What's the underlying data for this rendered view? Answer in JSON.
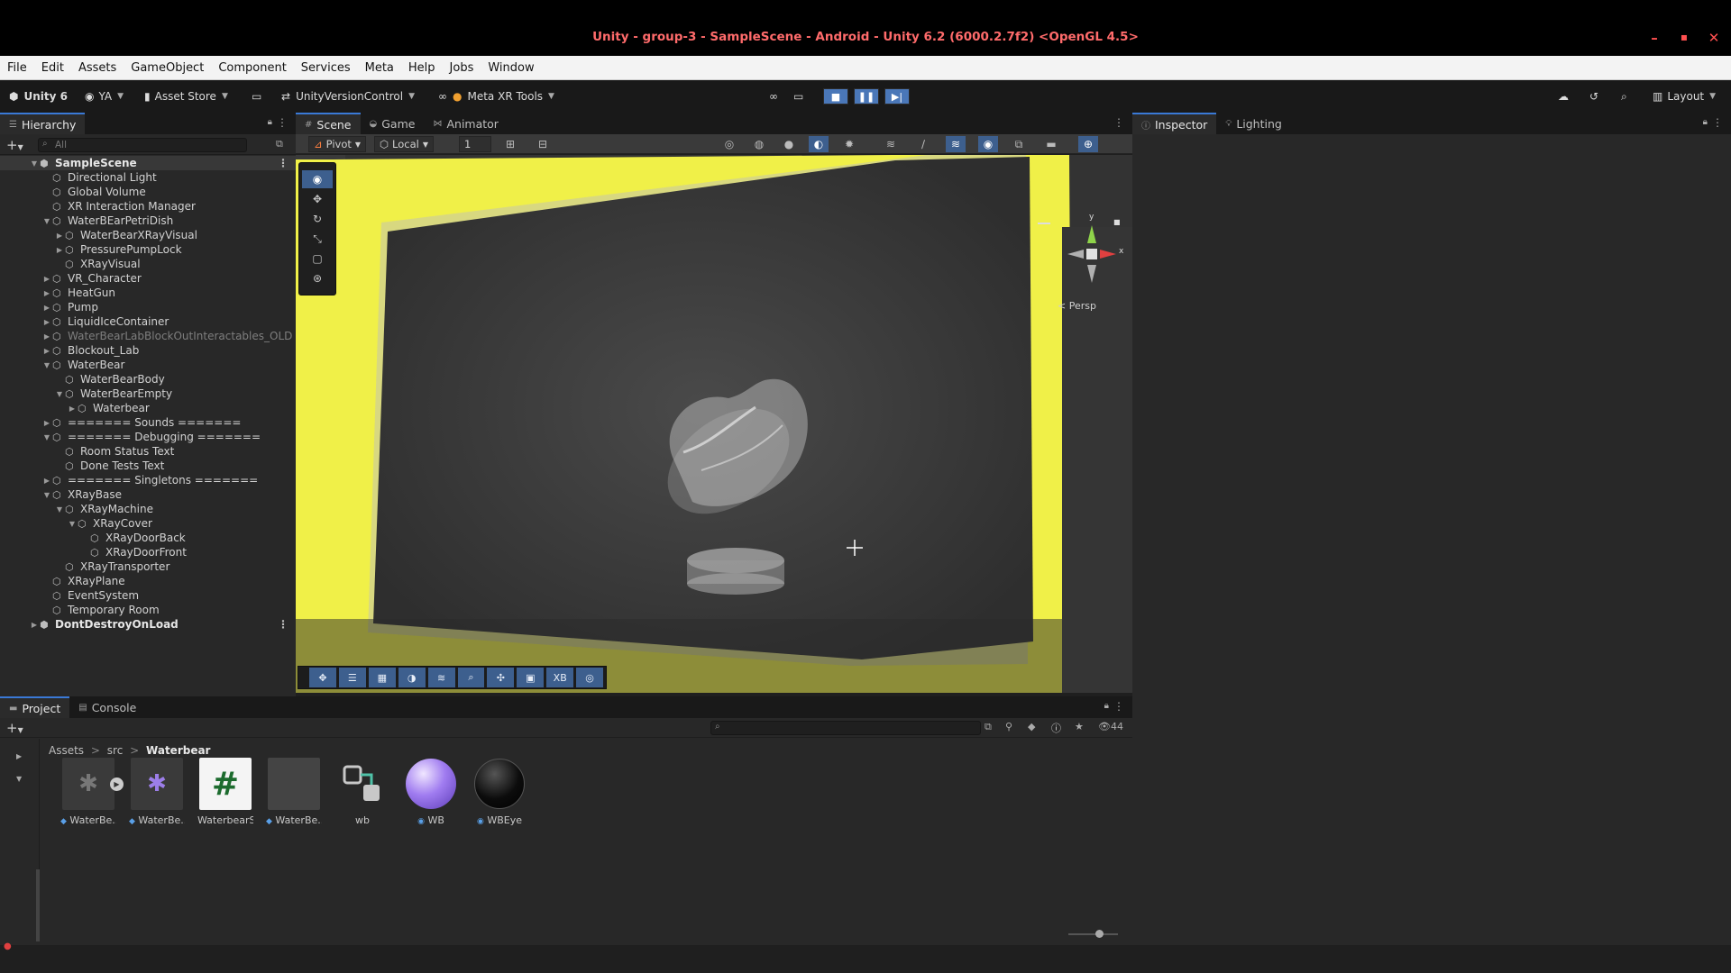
{
  "window": {
    "title": "Unity - group-3 - SampleScene - Android - Unity 6.2 (6000.2.7f2) <OpenGL 4.5>",
    "controls": [
      "–",
      "▪",
      "✕"
    ]
  },
  "menu": [
    "File",
    "Edit",
    "Assets",
    "GameObject",
    "Component",
    "Services",
    "Meta",
    "Help",
    "Jobs",
    "Window"
  ],
  "toolbar": {
    "unity": "Unity 6",
    "account": "YA",
    "asset_store": "Asset Store",
    "vcs": "UnityVersionControl",
    "meta": "Meta XR Tools",
    "layout": "Layout"
  },
  "hierarchy": {
    "tab": "Hierarchy",
    "search_placeholder": "All",
    "rows": [
      {
        "label": "SampleScene",
        "depth": 0,
        "arrow": "▼",
        "kind": "scene"
      },
      {
        "label": "Directional Light",
        "depth": 1,
        "arrow": ""
      },
      {
        "label": "Global Volume",
        "depth": 1,
        "arrow": ""
      },
      {
        "label": "XR Interaction Manager",
        "depth": 1,
        "arrow": ""
      },
      {
        "label": "WaterBEarPetriDish",
        "depth": 1,
        "arrow": "▼"
      },
      {
        "label": "WaterBearXRayVisual",
        "depth": 2,
        "arrow": "▶"
      },
      {
        "label": "PressurePumpLock",
        "depth": 2,
        "arrow": "▶"
      },
      {
        "label": "XRayVisual",
        "depth": 2,
        "arrow": ""
      },
      {
        "label": "VR_Character",
        "depth": 1,
        "arrow": "▶"
      },
      {
        "label": "HeatGun",
        "depth": 1,
        "arrow": "▶"
      },
      {
        "label": "Pump",
        "depth": 1,
        "arrow": "▶"
      },
      {
        "label": "LiquidIceContainer",
        "depth": 1,
        "arrow": "▶"
      },
      {
        "label": "WaterBearLabBlockOutInteractables_OLD",
        "depth": 1,
        "arrow": "▶",
        "kind": "dim"
      },
      {
        "label": "Blockout_Lab",
        "depth": 1,
        "arrow": "▶"
      },
      {
        "label": "WaterBear",
        "depth": 1,
        "arrow": "▼"
      },
      {
        "label": "WaterBearBody",
        "depth": 2,
        "arrow": ""
      },
      {
        "label": "WaterBearEmpty",
        "depth": 2,
        "arrow": "▼"
      },
      {
        "label": "Waterbear",
        "depth": 3,
        "arrow": "▶"
      },
      {
        "label": "======= Sounds =======",
        "depth": 1,
        "arrow": "▶"
      },
      {
        "label": "======= Debugging =======",
        "depth": 1,
        "arrow": "▼"
      },
      {
        "label": "Room Status Text",
        "depth": 2,
        "arrow": ""
      },
      {
        "label": "Done Tests Text",
        "depth": 2,
        "arrow": ""
      },
      {
        "label": "======= Singletons =======",
        "depth": 1,
        "arrow": "▶"
      },
      {
        "label": "XRayBase",
        "depth": 1,
        "arrow": "▼"
      },
      {
        "label": "XRayMachine",
        "depth": 2,
        "arrow": "▼"
      },
      {
        "label": "XRayCover",
        "depth": 3,
        "arrow": "▼"
      },
      {
        "label": "XRayDoorBack",
        "depth": 4,
        "arrow": ""
      },
      {
        "label": "XRayDoorFront",
        "depth": 4,
        "arrow": ""
      },
      {
        "label": "XRayTransporter",
        "depth": 2,
        "arrow": ""
      },
      {
        "label": "XRayPlane",
        "depth": 1,
        "arrow": ""
      },
      {
        "label": "EventSystem",
        "depth": 1,
        "arrow": ""
      },
      {
        "label": "Temporary Room",
        "depth": 1,
        "arrow": ""
      },
      {
        "label": "DontDestroyOnLoad",
        "depth": 0,
        "arrow": "▶",
        "kind": "scene"
      }
    ]
  },
  "scene": {
    "tabs": [
      "Scene",
      "Game",
      "Animator"
    ],
    "pivot": "Pivot",
    "local": "Local",
    "snap": "1",
    "persp": "< Persp",
    "gizmo_y": "y",
    "gizmo_x": "x",
    "overlay_label": "XB"
  },
  "inspector": {
    "tabs": [
      "Inspector",
      "Lighting"
    ]
  },
  "project": {
    "tabs": [
      "Project",
      "Console"
    ],
    "breadcrumb": [
      "Assets",
      "src",
      "Waterbear"
    ],
    "hidden_count": "44",
    "assets": [
      {
        "label": "WaterBe..."
      },
      {
        "label": "WaterBe..."
      },
      {
        "label": "WaterbearS..."
      },
      {
        "label": "WaterBe..."
      },
      {
        "label": "wb"
      },
      {
        "label": "WB"
      },
      {
        "label": "WBEye"
      }
    ]
  },
  "colors": {
    "accent": "#3a79d6",
    "title_text": "#ff6b6b",
    "frame_yellow": "#f0f048"
  }
}
